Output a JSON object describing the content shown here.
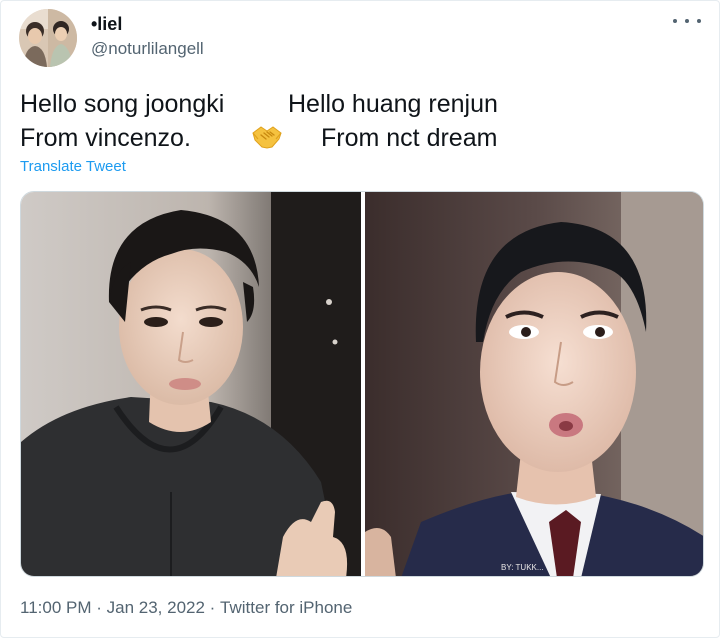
{
  "user": {
    "display_name": "•liel",
    "handle": "@noturlilangell"
  },
  "tweet": {
    "line1_left": "Hello song joongki",
    "line1_right": "Hello huang renjun",
    "line2_left": "From vincenzo.",
    "line2_right": "From nct dream",
    "emoji": "handshake-icon",
    "translate_label": "Translate Tweet"
  },
  "media": {
    "watermark": "BY: TUKK..."
  },
  "footer": {
    "time": "11:00 PM",
    "sep1": " · ",
    "date": "Jan 23, 2022",
    "sep2": " · ",
    "source": "Twitter for iPhone"
  },
  "colors": {
    "link": "#1d9bf0",
    "secondary_text": "#536471"
  }
}
